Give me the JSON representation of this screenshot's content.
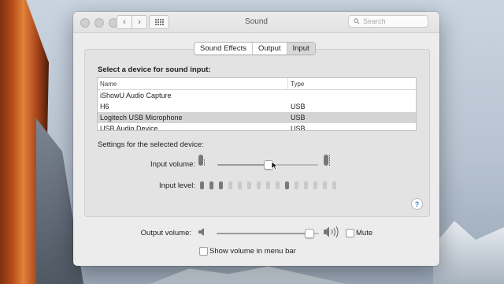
{
  "window": {
    "title": "Sound",
    "search_placeholder": "Search",
    "back_glyph": "‹",
    "forward_glyph": "›",
    "grid_icon": "show-all-grid-icon"
  },
  "tabs": [
    {
      "label": "Sound Effects",
      "selected": false
    },
    {
      "label": "Output",
      "selected": false
    },
    {
      "label": "Input",
      "selected": true
    }
  ],
  "input": {
    "heading": "Select a device for sound input:",
    "table": {
      "columns": [
        "Name",
        "Type"
      ],
      "rows": [
        {
          "name": "iShowU Audio Capture",
          "type": "",
          "selected": false
        },
        {
          "name": "H6",
          "type": "USB",
          "selected": false
        },
        {
          "name": "Logitech USB Microphone",
          "type": "USB",
          "selected": true
        },
        {
          "name": "USB Audio Device",
          "type": "USB",
          "selected": false
        }
      ]
    },
    "settings_label": "Settings for the selected device:",
    "volume_label": "Input volume:",
    "volume_fraction": 0.5,
    "level_label": "Input level:",
    "level_bars_total": 15,
    "level_bars_on": [
      0,
      1,
      2,
      9
    ]
  },
  "output": {
    "volume_label": "Output volume:",
    "volume_fraction": 0.9,
    "mute_label": "Mute",
    "mute_checked": false,
    "menu_bar_label": "Show volume in menu bar",
    "menu_bar_checked": false
  },
  "help_glyph": "?",
  "colors": {
    "window_bg": "#ececec",
    "panel_bg": "#e3e3e3",
    "selected_row": "#d5d5d5",
    "help_accent": "#3b82d6"
  }
}
